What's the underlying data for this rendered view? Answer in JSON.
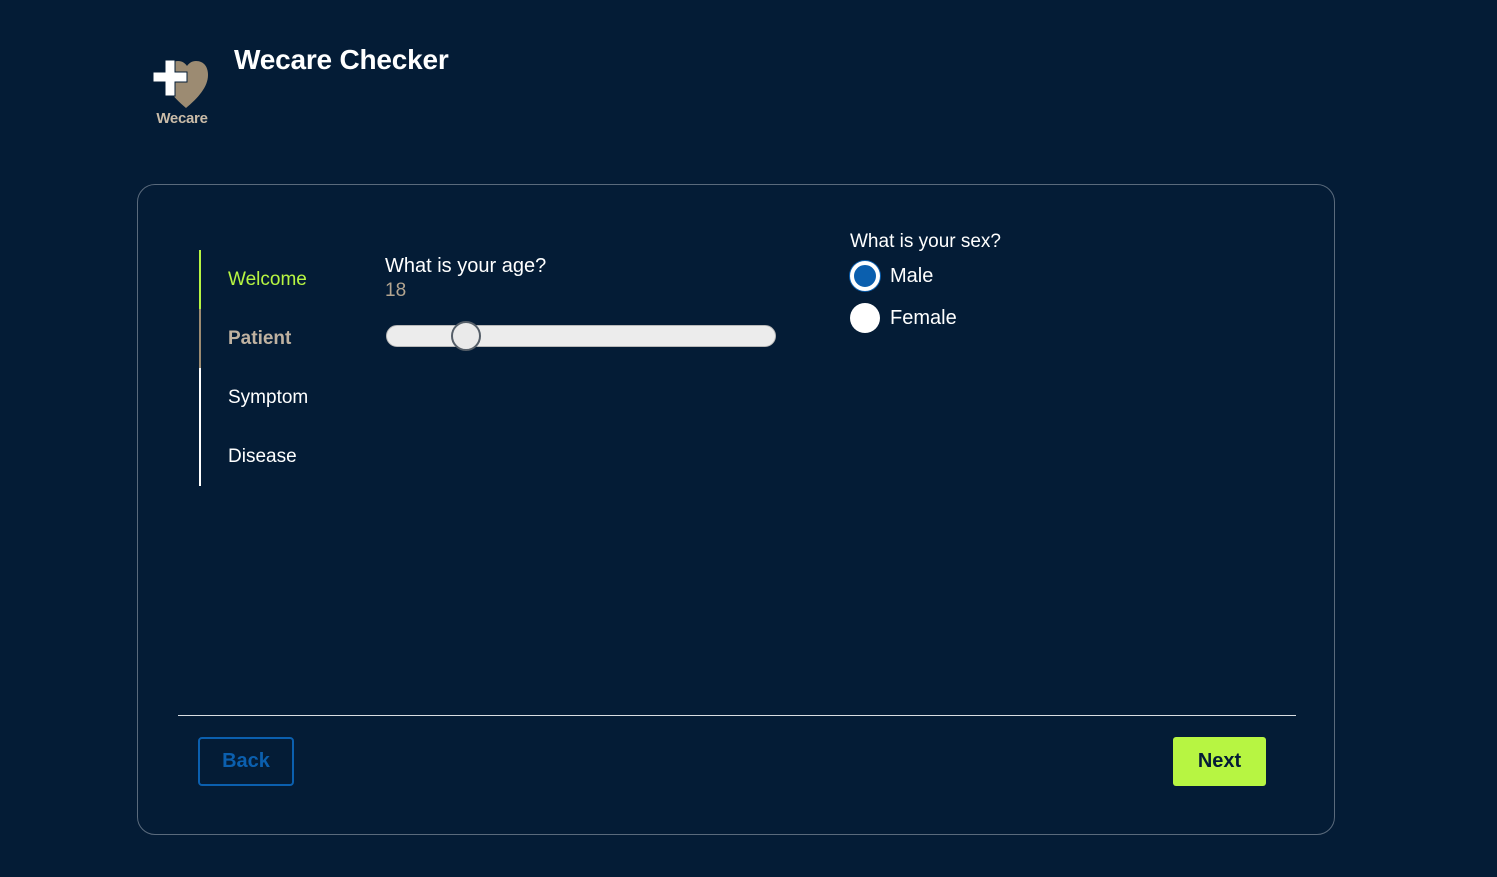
{
  "header": {
    "logo_text": "Wecare",
    "title": "Wecare Checker"
  },
  "stepper": {
    "steps": [
      {
        "label": "Welcome",
        "state": "active"
      },
      {
        "label": "Patient",
        "state": "done"
      },
      {
        "label": "Symptom",
        "state": "pending"
      },
      {
        "label": "Disease",
        "state": "pending"
      }
    ]
  },
  "age": {
    "question": "What is your age?",
    "value": "18",
    "slider_fraction": 0.18
  },
  "sex": {
    "question": "What is your sex?",
    "options": [
      {
        "label": "Male",
        "checked": true
      },
      {
        "label": "Female",
        "checked": false
      }
    ]
  },
  "footer": {
    "back_label": "Back",
    "next_label": "Next"
  },
  "colors": {
    "background": "#041c36",
    "accent": "#b7f542",
    "primary_blue": "#0b5fae",
    "logo_tan": "#9c8b72"
  }
}
